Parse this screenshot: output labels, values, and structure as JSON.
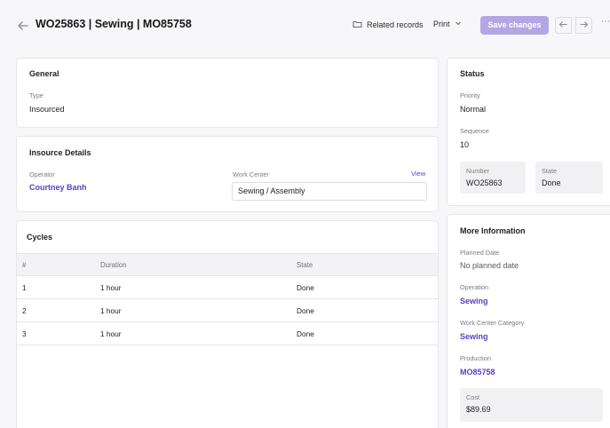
{
  "header": {
    "title": "WO25863 | Sewing | MO85758",
    "related_label": "Related records",
    "print_label": "Print",
    "save_label": "Save changes"
  },
  "general": {
    "title": "General",
    "type_label": "Type",
    "type_value": "Insourced"
  },
  "insource": {
    "title": "Insource Details",
    "operator_label": "Operator",
    "operator_value": "Courtney Banh",
    "work_center_label": "Work Center",
    "view_link": "View",
    "work_center_value": "Sewing / Assembly"
  },
  "cycles": {
    "title": "Cycles",
    "columns": [
      "#",
      "Duration",
      "State"
    ],
    "rows": [
      [
        "1",
        "1 hour",
        "Done"
      ],
      [
        "2",
        "1 hour",
        "Done"
      ],
      [
        "3",
        "1 hour",
        "Done"
      ]
    ]
  },
  "status": {
    "title": "Status",
    "priority_label": "Priority",
    "priority_value": "Normal",
    "sequence_label": "Sequence",
    "sequence_value": "10",
    "number_label": "Number",
    "number_value": "WO25863",
    "state_label": "State",
    "state_value": "Done"
  },
  "more_info": {
    "title": "More Information",
    "planned_date_label": "Planned Date",
    "planned_date_value": "No planned date",
    "operation_label": "Operation",
    "operation_value": "Sewing",
    "wc_category_label": "Work Center Category",
    "wc_category_value": "Sewing",
    "production_label": "Production",
    "production_value": "MO85758",
    "cost_label": "Cost",
    "cost_value": "$89.69"
  },
  "colors": {
    "accent": "#5b3fc4",
    "save_button": "#b3a7e3"
  }
}
